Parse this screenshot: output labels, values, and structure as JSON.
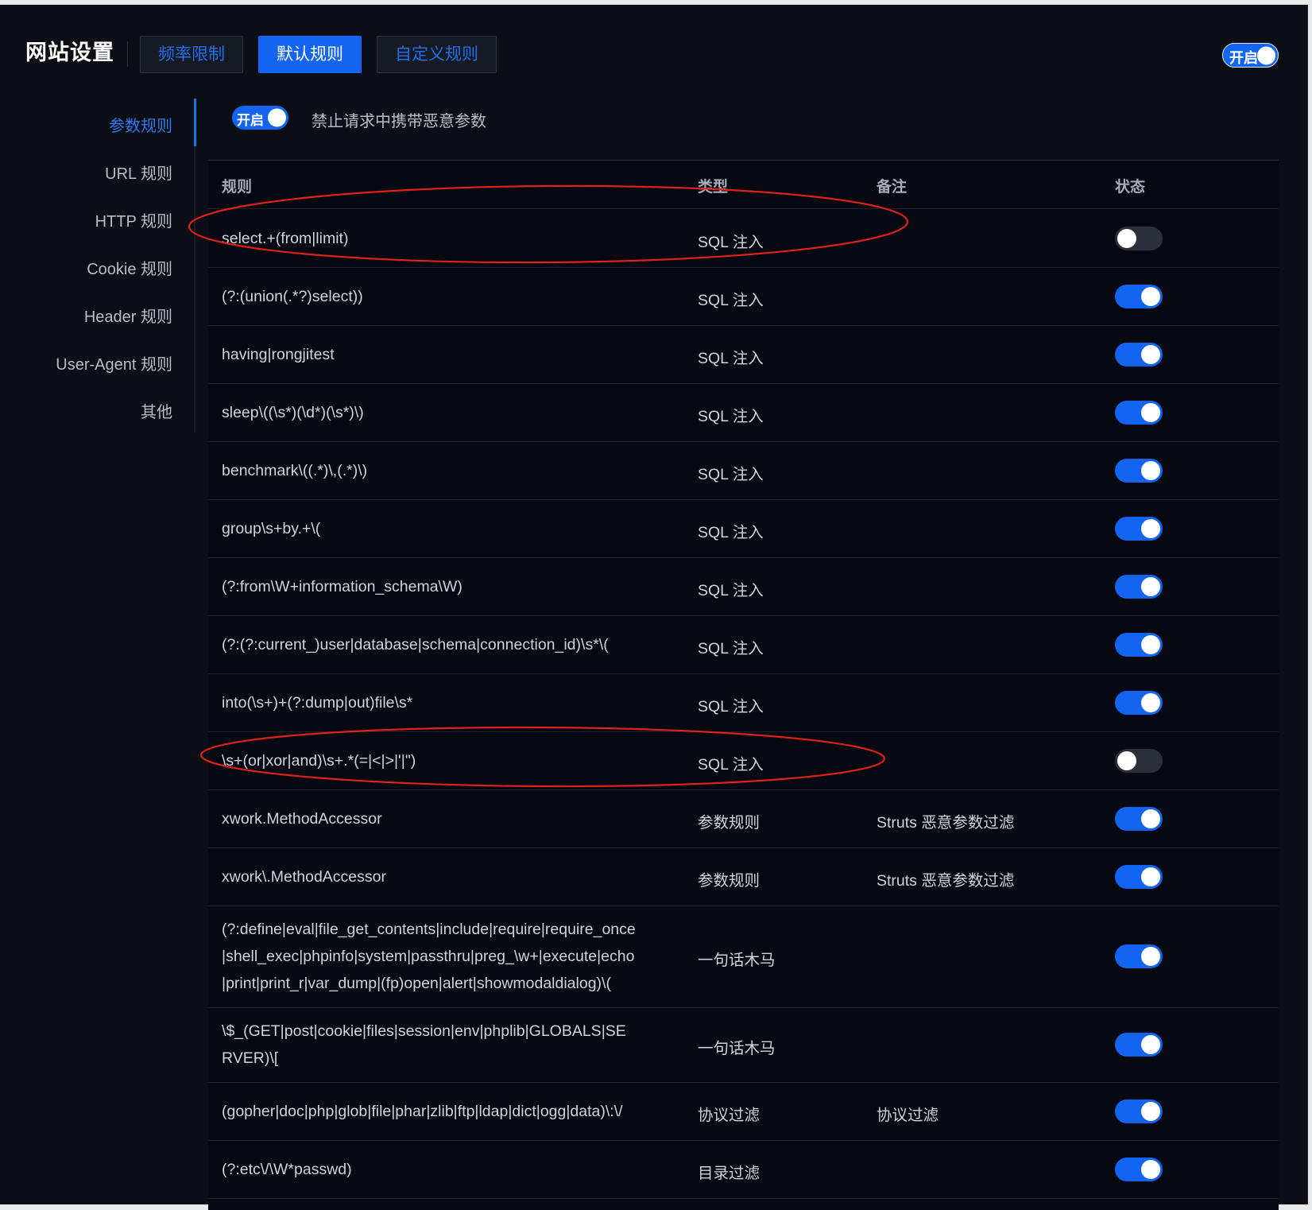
{
  "header": {
    "title": "网站设置",
    "tabs": [
      {
        "label": "频率限制",
        "active": false
      },
      {
        "label": "默认规则",
        "active": true
      },
      {
        "label": "自定义规则",
        "active": false
      }
    ],
    "global_switch": {
      "label": "开启",
      "on": true
    }
  },
  "sidebar": {
    "items": [
      {
        "label": "参数规则",
        "active": true
      },
      {
        "label": "URL 规则",
        "active": false
      },
      {
        "label": "HTTP 规则",
        "active": false
      },
      {
        "label": "Cookie 规则",
        "active": false
      },
      {
        "label": "Header 规则",
        "active": false
      },
      {
        "label": "User-Agent 规则",
        "active": false
      },
      {
        "label": "其他",
        "active": false
      }
    ]
  },
  "section": {
    "switch_label": "开启",
    "switch_on": true,
    "description": "禁止请求中携带恶意参数"
  },
  "table": {
    "columns": [
      "规则",
      "类型",
      "备注",
      "状态"
    ],
    "rows": [
      {
        "rule": [
          "select.+(from|limit)"
        ],
        "type": "SQL 注入",
        "note": "",
        "enabled": false
      },
      {
        "rule": [
          "(?:(union(.*?)select))"
        ],
        "type": "SQL 注入",
        "note": "",
        "enabled": true
      },
      {
        "rule": [
          "having|rongjitest"
        ],
        "type": "SQL 注入",
        "note": "",
        "enabled": true
      },
      {
        "rule": [
          "sleep\\((\\s*)(\\d*)(\\s*)\\)"
        ],
        "type": "SQL 注入",
        "note": "",
        "enabled": true
      },
      {
        "rule": [
          "benchmark\\((.*)\\,(.*)\\)"
        ],
        "type": "SQL 注入",
        "note": "",
        "enabled": true
      },
      {
        "rule": [
          "group\\s+by.+\\("
        ],
        "type": "SQL 注入",
        "note": "",
        "enabled": true
      },
      {
        "rule": [
          "(?:from\\W+information_schema\\W)"
        ],
        "type": "SQL 注入",
        "note": "",
        "enabled": true
      },
      {
        "rule": [
          "(?:(?:current_)user|database|schema|connection_id)\\s*\\("
        ],
        "type": "SQL 注入",
        "note": "",
        "enabled": true
      },
      {
        "rule": [
          "into(\\s+)+(?:dump|out)file\\s*"
        ],
        "type": "SQL 注入",
        "note": "",
        "enabled": true
      },
      {
        "rule": [
          "\\s+(or|xor|and)\\s+.*(=|<|>|'|\")"
        ],
        "type": "SQL 注入",
        "note": "",
        "enabled": false
      },
      {
        "rule": [
          "xwork.MethodAccessor"
        ],
        "type": "参数规则",
        "note": "Struts 恶意参数过滤",
        "enabled": true
      },
      {
        "rule": [
          "xwork\\.MethodAccessor"
        ],
        "type": "参数规则",
        "note": "Struts 恶意参数过滤",
        "enabled": true
      },
      {
        "rule": [
          "(?:define|eval|file_get_contents|include|require|require_once",
          "|shell_exec|phpinfo|system|passthru|preg_\\w+|execute|echo",
          "|print|print_r|var_dump|(fp)open|alert|showmodaldialog)\\("
        ],
        "type": "一句话木马",
        "note": "",
        "enabled": true
      },
      {
        "rule": [
          "\\$_(GET|post|cookie|files|session|env|phplib|GLOBALS|SE",
          "RVER)\\["
        ],
        "type": "一句话木马",
        "note": "",
        "enabled": true
      },
      {
        "rule": [
          "(gopher|doc|php|glob|file|phar|zlib|ftp|ldap|dict|ogg|data)\\:\\/"
        ],
        "type": "协议过滤",
        "note": "协议过滤",
        "enabled": true
      },
      {
        "rule": [
          "(?:etc\\/\\W*passwd)"
        ],
        "type": "目录过滤",
        "note": "",
        "enabled": true
      }
    ]
  },
  "colors": {
    "accent": "#1464f2",
    "annotation": "#e0201a",
    "background": "#0b0e14"
  }
}
